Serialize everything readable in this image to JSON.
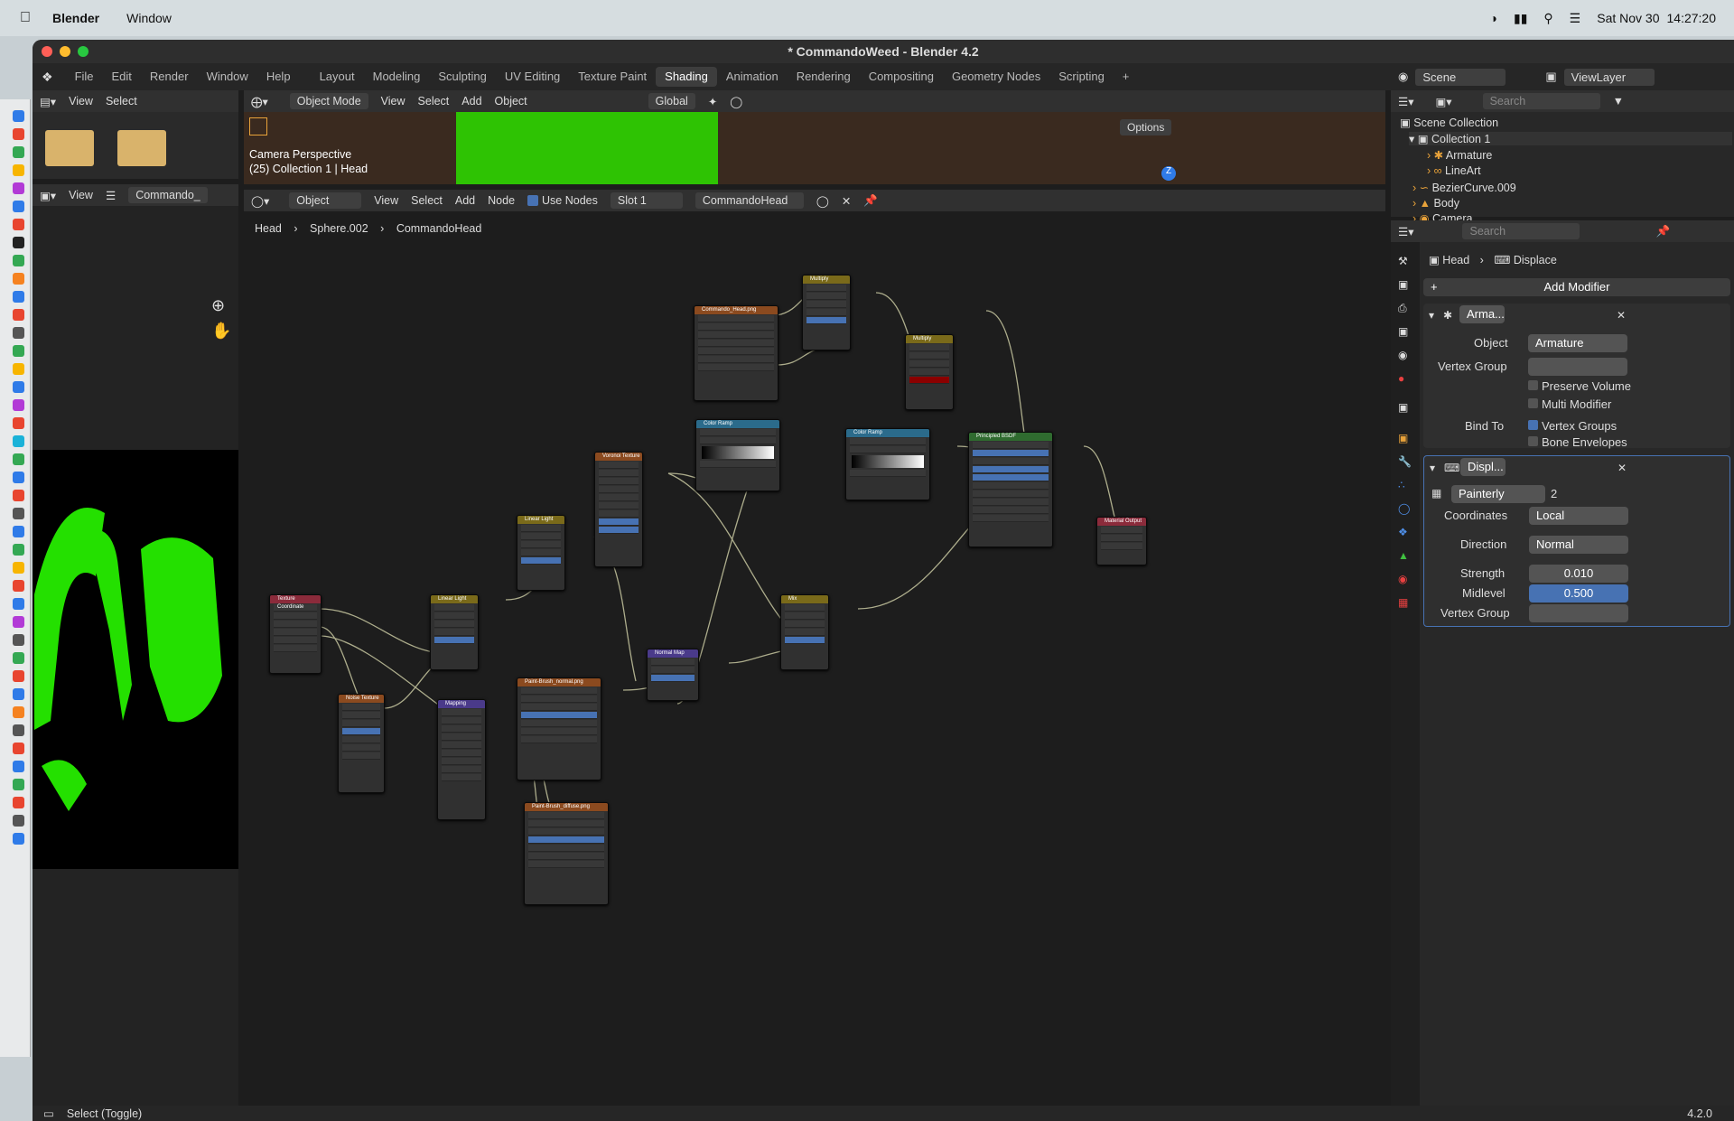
{
  "menubar": {
    "app_name": "Blender",
    "menu_window": "Window",
    "date": "Sat Nov 30",
    "time": "14:27:20"
  },
  "window": {
    "title": "* CommandoWeed - Blender 4.2",
    "version": "4.2.0"
  },
  "topmenu": [
    "File",
    "Edit",
    "Render",
    "Window",
    "Help"
  ],
  "workspaces": [
    "Layout",
    "Modeling",
    "Sculpting",
    "UV Editing",
    "Texture Paint",
    "Shading",
    "Animation",
    "Rendering",
    "Compositing",
    "Geometry Nodes",
    "Scripting"
  ],
  "active_workspace": "Shading",
  "scene": {
    "scene_label": "Scene",
    "viewlayer_label": "ViewLayer"
  },
  "file_browser": {
    "view": "View",
    "select": "Select"
  },
  "viewport": {
    "mode": "Object Mode",
    "view": "View",
    "select": "Select",
    "add": "Add",
    "object": "Object",
    "transform": "Global",
    "options": "Options",
    "camera_label": "Camera Perspective",
    "collection_label": "(25) Collection 1 | Head"
  },
  "image_editor": {
    "view": "View",
    "image_name": "Commando_"
  },
  "node_editor": {
    "object": "Object",
    "view": "View",
    "select": "Select",
    "add": "Add",
    "node": "Node",
    "use_nodes": "Use Nodes",
    "slot": "Slot 1",
    "material": "CommandoHead",
    "breadcrumb": [
      "Head",
      "Sphere.002",
      "CommandoHead"
    ]
  },
  "outliner": {
    "search_placeholder": "Search",
    "items": [
      {
        "label": "Scene Collection"
      },
      {
        "label": "Collection 1"
      },
      {
        "label": "Armature"
      },
      {
        "label": "LineArt"
      },
      {
        "label": "BezierCurve.009"
      },
      {
        "label": "Body"
      },
      {
        "label": "Camera"
      }
    ]
  },
  "properties": {
    "search_placeholder": "Search",
    "breadcrumb_object": "Head",
    "breadcrumb_modifier": "Displace",
    "add_modifier": "Add Modifier",
    "armature_mod": {
      "name": "Arma...",
      "object_label": "Object",
      "object_value": "Armature",
      "vertex_group_label": "Vertex Group",
      "preserve_volume": "Preserve Volume",
      "multi_modifier": "Multi Modifier",
      "bind_to_label": "Bind To",
      "vertex_groups": "Vertex Groups",
      "bone_envelopes": "Bone Envelopes"
    },
    "displace_mod": {
      "name": "Displ...",
      "texture": "Painterly",
      "texture_users": "2",
      "coordinates_label": "Coordinates",
      "coordinates_value": "Local",
      "direction_label": "Direction",
      "direction_value": "Normal",
      "strength_label": "Strength",
      "strength_value": "0.010",
      "midlevel_label": "Midlevel",
      "midlevel_value": "0.500",
      "vertex_group_label": "Vertex Group"
    }
  },
  "statusbar": {
    "hint": "Select (Toggle)"
  },
  "nodes": [
    {
      "title": "Texture Coordinate",
      "color": "#8b2b3b"
    },
    {
      "title": "Noise Texture",
      "color": "#8b4a1f"
    },
    {
      "title": "Linear Light",
      "color": "#7a6a1a"
    },
    {
      "title": "Mapping",
      "color": "#4a3a8a"
    },
    {
      "title": "Linear Light",
      "color": "#7a6a1a"
    },
    {
      "title": "Paint-Brush_normal.png",
      "color": "#8b4a1f"
    },
    {
      "title": "Paint-Brush_diffuse.png",
      "color": "#8b4a1f"
    },
    {
      "title": "Voronoi Texture",
      "color": "#8b4a1f"
    },
    {
      "title": "Commando_Head.png",
      "color": "#8b4a1f"
    },
    {
      "title": "Color Ramp",
      "color": "#2b6b8b"
    },
    {
      "title": "Normal Map",
      "color": "#4a3a8a"
    },
    {
      "title": "Mix",
      "color": "#7a6a1a"
    },
    {
      "title": "Multiply",
      "color": "#7a6a1a"
    },
    {
      "title": "Multiply",
      "color": "#7a6a1a"
    },
    {
      "title": "Color Ramp",
      "color": "#2b6b8b"
    },
    {
      "title": "Principled BSDF",
      "color": "#2f6b2f"
    },
    {
      "title": "Material Output",
      "color": "#8b2b3b"
    }
  ]
}
